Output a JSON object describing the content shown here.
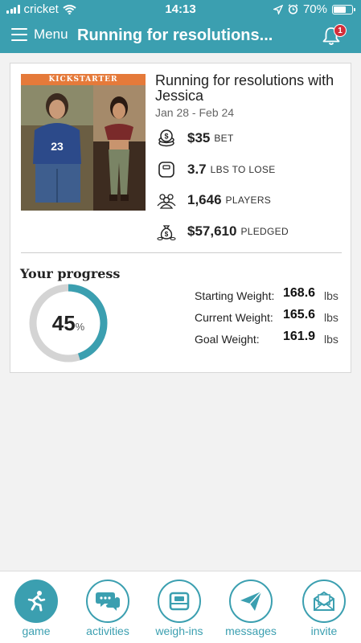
{
  "status_bar": {
    "carrier": "cricket",
    "time": "14:13",
    "battery": "70%",
    "battery_level": 0.7
  },
  "header": {
    "menu_label": "Menu",
    "title": "Running for resolutions...",
    "notification_count": "1"
  },
  "game": {
    "banner": "KICKSTARTER",
    "title": "Running for resolutions with Jessica",
    "dates": "Jan 28 - Feb 24",
    "stats": [
      {
        "icon": "coins-icon",
        "value": "$35",
        "label": "BET"
      },
      {
        "icon": "scale-icon",
        "value": "3.7",
        "label": "LBS TO LOSE"
      },
      {
        "icon": "players-icon",
        "value": "1,646",
        "label": "PLAYERS"
      },
      {
        "icon": "money-bag-icon",
        "value": "$57,610",
        "label": "PLEDGED"
      }
    ]
  },
  "progress": {
    "title": "Your progress",
    "percent": "45",
    "percent_symbol": "%",
    "percent_value": 0.45,
    "weights": [
      {
        "label": "Starting Weight:",
        "value": "168.6",
        "unit": "lbs"
      },
      {
        "label": "Current Weight:",
        "value": "165.6",
        "unit": "lbs"
      },
      {
        "label": "Goal Weight:",
        "value": "161.9",
        "unit": "lbs"
      }
    ]
  },
  "tabs": [
    {
      "label": "game",
      "icon": "runner-icon",
      "active": true
    },
    {
      "label": "activities",
      "icon": "chat-bubbles-icon",
      "active": false
    },
    {
      "label": "weigh-ins",
      "icon": "scale-icon",
      "active": false
    },
    {
      "label": "messages",
      "icon": "paper-plane-icon",
      "active": false
    },
    {
      "label": "invite",
      "icon": "envelope-icon",
      "active": false
    }
  ],
  "colors": {
    "primary": "#3b9fb0",
    "badge": "#d32f3a",
    "banner": "#e57a3a",
    "ring_track": "#d4d4d4"
  }
}
